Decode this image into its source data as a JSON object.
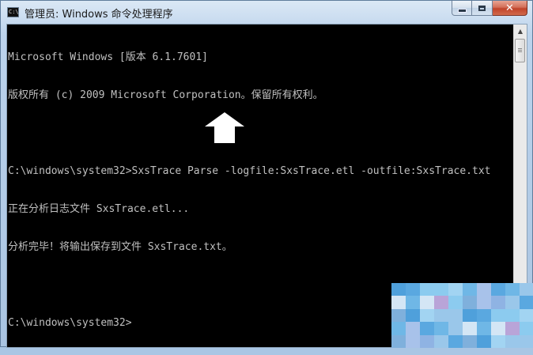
{
  "window": {
    "title": "管理员: Windows 命令处理程序",
    "icon": "cmd-icon",
    "icon_text": "C:\\",
    "buttons": {
      "minimize": "minimize-icon",
      "maximize": "maximize-icon",
      "close": "close-icon",
      "close_glyph": "✕"
    }
  },
  "console": {
    "lines": [
      "Microsoft Windows [版本 6.1.7601]",
      "版权所有 (c) 2009 Microsoft Corporation。保留所有权利。",
      "",
      "C:\\windows\\system32>SxsTrace Parse -logfile:SxsTrace.etl -outfile:SxsTrace.txt",
      "正在分析日志文件 SxsTrace.etl...",
      "分析完毕！将输出保存到文件 SxsTrace.txt。",
      "",
      "C:\\windows\\system32>"
    ],
    "text_color": "#c0c0c0",
    "background": "#000000"
  },
  "scrollbar": {
    "up_arrow": "▲"
  },
  "annotation": {
    "icon": "up-arrow-icon",
    "color": "#ffffff"
  }
}
